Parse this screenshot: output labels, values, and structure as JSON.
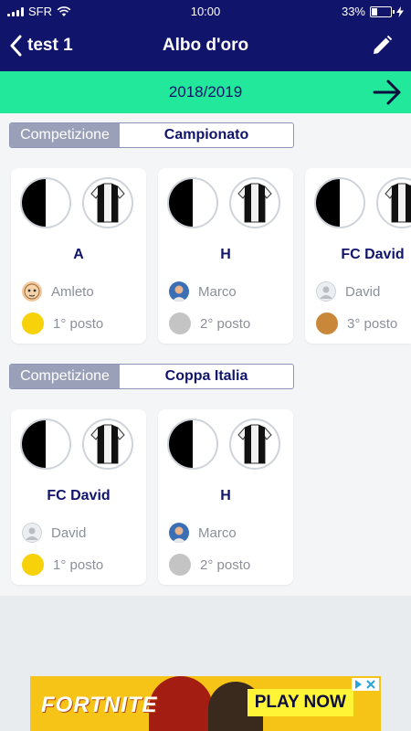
{
  "status_bar": {
    "carrier": "SFR",
    "time": "10:00",
    "battery": "33%",
    "battery_fraction": 0.33
  },
  "nav": {
    "back_label": "test 1",
    "title": "Albo d'oro"
  },
  "season": {
    "label": "2018/2019"
  },
  "sections": [
    {
      "competition_label": "Competizione",
      "competition_value": "Campionato",
      "cards": [
        {
          "team": "A",
          "user": "Amleto",
          "place": "1° posto",
          "medal_color": "#f7d10a"
        },
        {
          "team": "H",
          "user": "Marco",
          "place": "2° posto",
          "medal_color": "#c4c4c4"
        },
        {
          "team": "FC David",
          "user": "David",
          "place": "3° posto",
          "medal_color": "#c9873a"
        }
      ]
    },
    {
      "competition_label": "Competizione",
      "competition_value": "Coppa Italia",
      "cards": [
        {
          "team": "FC David",
          "user": "David",
          "place": "1° posto",
          "medal_color": "#f7d10a"
        },
        {
          "team": "H",
          "user": "Marco",
          "place": "2° posto",
          "medal_color": "#c4c4c4"
        }
      ]
    }
  ],
  "ad": {
    "brand": "FORTNITE",
    "cta": "PLAY NOW"
  },
  "colors": {
    "navy": "#11146b",
    "accent_green": "#21e89a",
    "gold": "#f7d10a",
    "silver": "#c4c4c4",
    "bronze": "#c9873a"
  }
}
